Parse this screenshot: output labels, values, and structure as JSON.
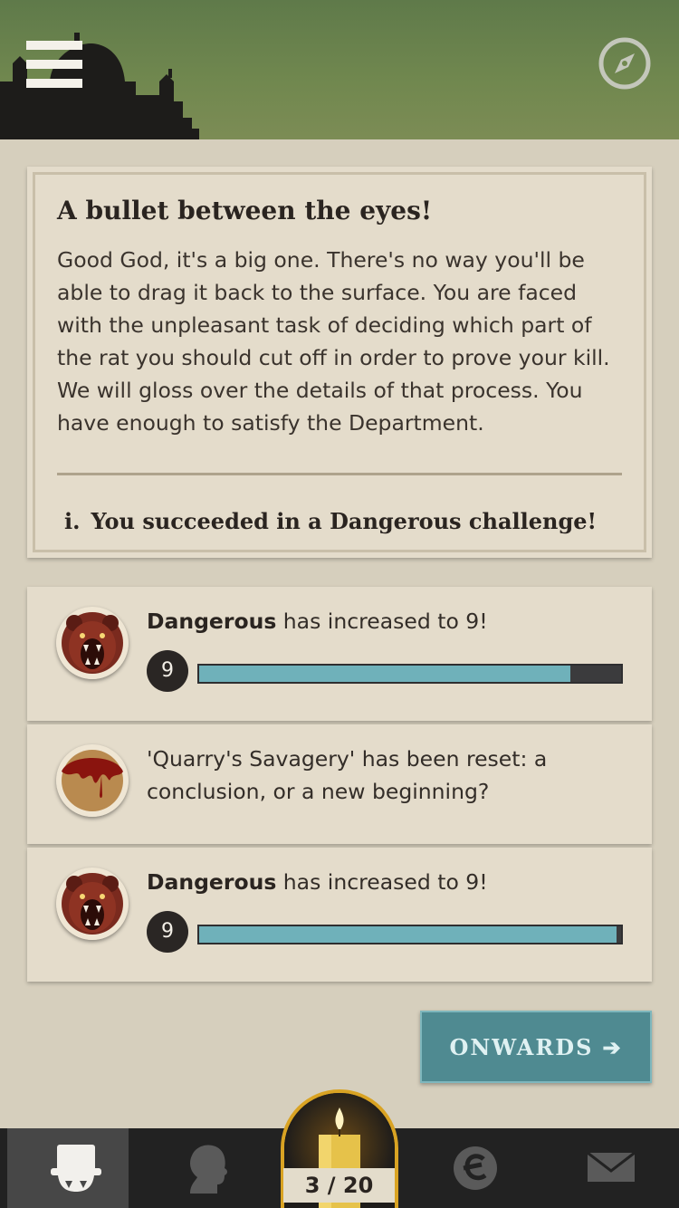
{
  "header": {
    "menu_icon": "hamburger-menu-icon",
    "compass_icon": "compass-icon",
    "background_color": "#6b844c"
  },
  "story": {
    "title": "A bullet between the eyes!",
    "body": "Good God, it's a big one. There's no way you'll be able to drag it back to the surface. You are faced with the unpleasant task of deciding which part of the rat you should cut off in order to prove your kill. We will gloss over the details of that process. You have enough to satisfy the Department.",
    "result_number": "i.",
    "result_text": "You succeeded in a Dangerous challenge!"
  },
  "quality_changes": [
    {
      "icon": "bear-icon",
      "quality": "Dangerous",
      "text": " has increased to 9!",
      "level": "9",
      "progress": 0.88
    },
    {
      "icon": "blood-stain-icon",
      "text": "'Quarry's Savagery' has been reset: a conclusion, or a new beginning?"
    },
    {
      "icon": "bear-icon",
      "quality": "Dangerous",
      "text": " has increased to 9!",
      "level": "9",
      "progress": 0.99
    }
  ],
  "onwards": {
    "label": "ONWARDS",
    "arrow_icon": "arrow-right-icon",
    "color": "#4f8a91"
  },
  "bottom_nav": {
    "items": [
      {
        "icon": "top-hat-icon",
        "active": true
      },
      {
        "icon": "profile-silhouette-icon",
        "active": false
      },
      {
        "icon": "candle-icon",
        "active": false
      },
      {
        "icon": "echo-currency-icon",
        "active": false
      },
      {
        "icon": "envelope-icon",
        "active": false
      }
    ],
    "actions": "3 / 20",
    "accent_color": "#d9a323"
  }
}
